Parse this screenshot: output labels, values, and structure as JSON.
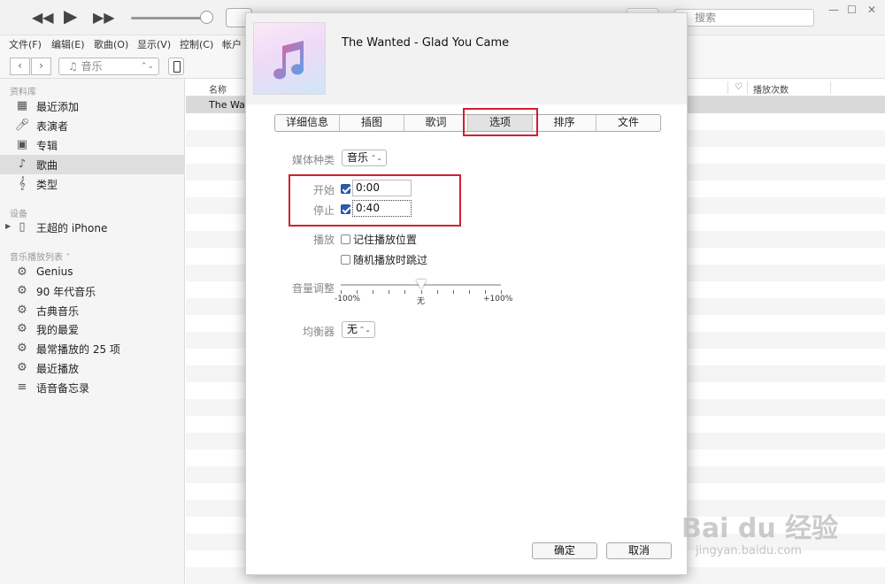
{
  "player": {
    "prev_icon": "rewind-icon",
    "play_icon": "play-icon",
    "next_icon": "fast-forward-icon",
    "volume_fraction": 0.9,
    "search_placeholder": "搜索"
  },
  "menu": {
    "items": [
      "文件(F)",
      "编辑(E)",
      "歌曲(O)",
      "显示(V)",
      "控制(C)",
      "帐户"
    ]
  },
  "nav": {
    "back": "‹",
    "forward": "›",
    "media_label": "音乐"
  },
  "sidebar": {
    "library_title": "资料库",
    "library_items": [
      {
        "label": "最近添加",
        "icon": "grid-icon"
      },
      {
        "label": "表演者",
        "icon": "microphone-icon"
      },
      {
        "label": "专辑",
        "icon": "album-icon"
      },
      {
        "label": "歌曲",
        "icon": "music-note-icon"
      },
      {
        "label": "类型",
        "icon": "genre-icon"
      }
    ],
    "devices_title": "设备",
    "device_name": "王超的 iPhone",
    "playlists_title": "音乐播放列表 ˅",
    "playlists": [
      {
        "label": "Genius"
      },
      {
        "label": "90 年代音乐"
      },
      {
        "label": "古典音乐"
      },
      {
        "label": "我的最爱"
      },
      {
        "label": "最常播放的 25 项"
      },
      {
        "label": "最近播放"
      },
      {
        "label": "语音备忘录"
      }
    ]
  },
  "list": {
    "col_name": "名称",
    "col_heart": "♡",
    "col_plays": "播放次数",
    "first_row": "The Wan"
  },
  "dialog": {
    "title": "The Wanted - Glad You Came",
    "tabs": [
      "详细信息",
      "插图",
      "歌词",
      "选项",
      "排序",
      "文件"
    ],
    "selected_tab": "选项",
    "media_kind_label": "媒体种类",
    "media_kind_value": "音乐",
    "start_label": "开始",
    "start_value": "0:00",
    "stop_label": "停止",
    "stop_value": "0:40",
    "playback_label": "播放",
    "remember_position": "记住播放位置",
    "skip_shuffle": "随机播放时跳过",
    "volume_label": "音量调整",
    "volume_min": "-100%",
    "volume_mid": "无",
    "volume_max": "+100%",
    "eq_label": "均衡器",
    "eq_value": "无",
    "ok": "确定",
    "cancel": "取消"
  },
  "colors": {
    "highlight_box": "#d02030",
    "check_blue": "#2a5db0"
  },
  "watermark": {
    "main": "Bai du 经验",
    "sub": "jingyan.baidu.com"
  }
}
